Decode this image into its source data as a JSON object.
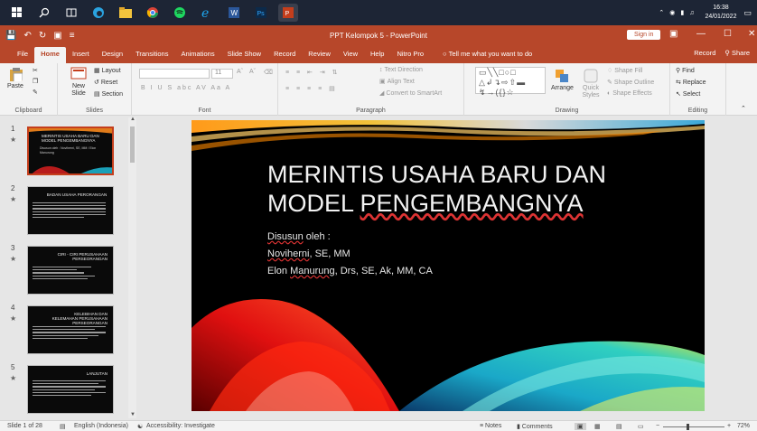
{
  "taskbar": {
    "icons": [
      "windows-start-icon",
      "search-icon",
      "task-view-icon",
      "edge-icon",
      "file-explorer-icon",
      "chrome-icon",
      "spotify-icon",
      "internet-explorer-icon",
      "word-icon",
      "photoshop-icon",
      "powerpoint-icon"
    ],
    "time": "16:38",
    "date": "24/01/2022"
  },
  "titlebar": {
    "title": "PPT Kelompok 5 - PowerPoint",
    "signin": "Sign in"
  },
  "tabs": [
    "File",
    "Home",
    "Insert",
    "Design",
    "Transitions",
    "Animations",
    "Slide Show",
    "Record",
    "Review",
    "View",
    "Help",
    "Nitro Pro"
  ],
  "active_tab": "Home",
  "tell_me": "Tell me what you want to do",
  "tab_right": {
    "record": "Record",
    "share": "Share"
  },
  "ribbon": {
    "clipboard": {
      "label": "Clipboard",
      "paste": "Paste"
    },
    "slides": {
      "label": "Slides",
      "new_slide": "New Slide",
      "layout": "Layout",
      "reset": "Reset",
      "section": "Section"
    },
    "font": {
      "label": "Font",
      "size": "11",
      "buttons": "B  I  U  S  abc  AV  Aa  A"
    },
    "paragraph": {
      "label": "Paragraph",
      "text_direction": "Text Direction",
      "align_text": "Align Text",
      "convert": "Convert to SmartArt"
    },
    "drawing": {
      "label": "Drawing",
      "arrange": "Arrange",
      "quick_styles": "Quick Styles",
      "shape_fill": "Shape Fill",
      "shape_outline": "Shape Outline",
      "shape_effects": "Shape Effects"
    },
    "editing": {
      "label": "Editing",
      "find": "Find",
      "replace": "Replace",
      "select": "Select"
    }
  },
  "thumbnails": [
    {
      "num": "1",
      "title": "Merintis Usaha Baru dan Model Pengembangnya",
      "sub": "Disusun oleh : Noviherni, SE, MM / Elon Manurung"
    },
    {
      "num": "2",
      "title": "Badan Usaha Perorangan"
    },
    {
      "num": "3",
      "title": "Ciri - Ciri Perusahaan Perseorangan"
    },
    {
      "num": "4",
      "title": "Kelebihan dan Kelemahan Perusahaan Perseorangan"
    },
    {
      "num": "5",
      "title": "Lanjutan"
    }
  ],
  "slide": {
    "title_line1": "MERINTIS USAHA BARU DAN",
    "title_line2_a": "MODEL ",
    "title_line2_b": "PENGEMBANGNYA",
    "sub1_a": "Disusun",
    "sub1_b": " oleh :",
    "sub2": "Noviherni",
    "sub2_b": ", SE, MM",
    "sub3_a": "Elon ",
    "sub3_b": "Manurung",
    "sub3_c": ", Drs, SE, Ak, MM, CA"
  },
  "status": {
    "slide_count": "Slide 1 of 28",
    "language": "English (Indonesia)",
    "accessibility": "Accessibility: Investigate",
    "notes": "Notes",
    "comments": "Comments",
    "zoom": "72%"
  }
}
